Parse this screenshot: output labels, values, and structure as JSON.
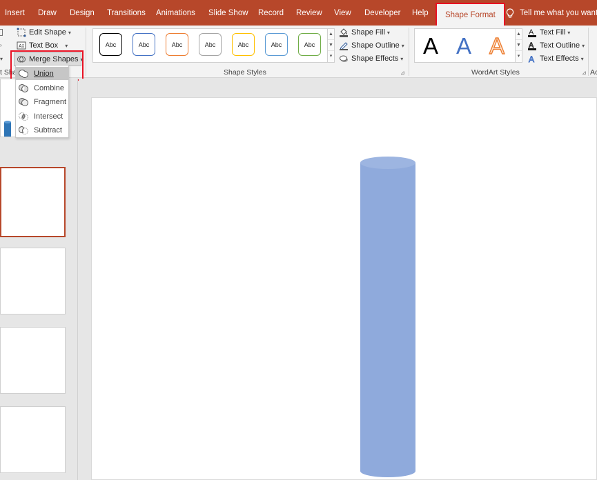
{
  "tabs": [
    {
      "label": "Insert"
    },
    {
      "label": "Draw"
    },
    {
      "label": "Design"
    },
    {
      "label": "Transitions"
    },
    {
      "label": "Animations"
    },
    {
      "label": "Slide Show"
    },
    {
      "label": "Record"
    },
    {
      "label": "Review"
    },
    {
      "label": "View"
    },
    {
      "label": "Developer"
    },
    {
      "label": "Help"
    },
    {
      "label": "Shape Format"
    }
  ],
  "tell_me": "Tell me what you want to",
  "insert_shapes": {
    "edit_shape": "Edit Shape",
    "text_box": "Text Box",
    "merge_shapes": "Merge Shapes",
    "group_label": "t Sha"
  },
  "merge_menu": {
    "items": [
      {
        "label": "Union"
      },
      {
        "label": "Combine"
      },
      {
        "label": "Fragment"
      },
      {
        "label": "Intersect"
      },
      {
        "label": "Subtract"
      }
    ],
    "hovered": "Union"
  },
  "shape_styles": {
    "gallery": [
      {
        "label": "Abc",
        "color": "#000000"
      },
      {
        "label": "Abc",
        "color": "#4472c4"
      },
      {
        "label": "Abc",
        "color": "#ed7d31"
      },
      {
        "label": "Abc",
        "color": "#a5a5a5"
      },
      {
        "label": "Abc",
        "color": "#ffc000"
      },
      {
        "label": "Abc",
        "color": "#5b9bd5"
      },
      {
        "label": "Abc",
        "color": "#70ad47"
      }
    ],
    "shape_fill": "Shape Fill",
    "shape_outline": "Shape Outline",
    "shape_effects": "Shape Effects",
    "group_label": "Shape Styles"
  },
  "wordart_styles": {
    "samples": [
      {
        "label": "A",
        "color": "#000000"
      },
      {
        "label": "A",
        "color": "#4472c4"
      },
      {
        "label": "A",
        "color": "#ed7d31"
      }
    ],
    "text_fill": "Text Fill",
    "text_outline": "Text Outline",
    "text_effects": "Text Effects",
    "group_label": "WordArt Styles",
    "next_group_label": "Ac"
  },
  "colors": {
    "accent": "#b7472a",
    "highlight": "#e81123",
    "cylinder_fill": "#8faadc"
  }
}
